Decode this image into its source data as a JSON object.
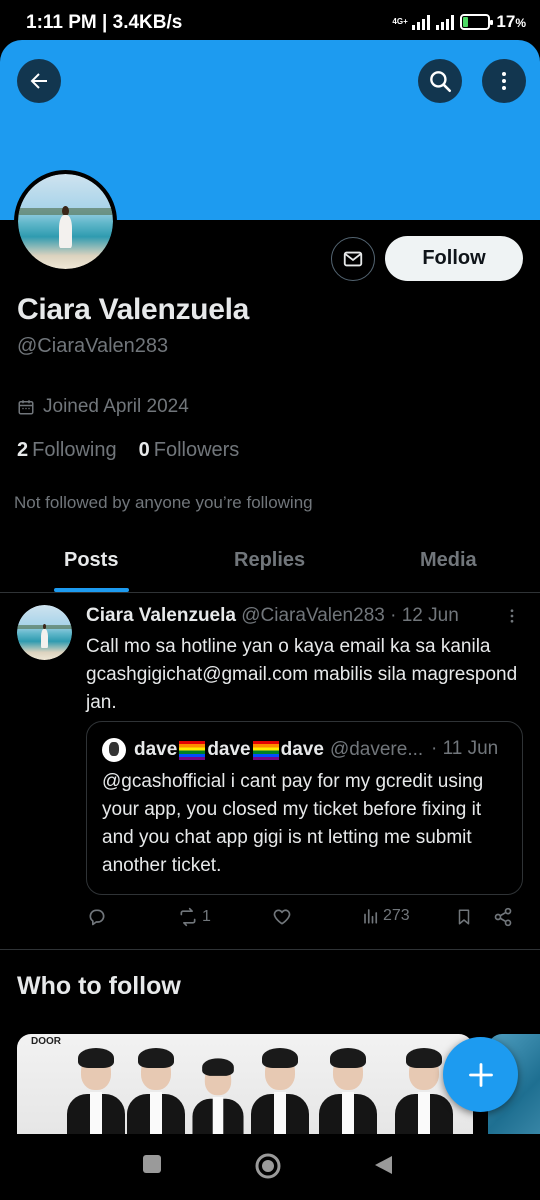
{
  "status_bar": {
    "time": "1:11 PM | 3.4KB/s",
    "network": "4G+",
    "battery": "17",
    "battery_suffix": "%"
  },
  "header": {
    "banner_color": "#1d9bf0",
    "back_icon": "arrow-left-icon",
    "search_icon": "search-icon",
    "more_icon": "more-vertical-icon"
  },
  "profile": {
    "display_name": "Ciara Valenzuela",
    "handle": "@CiaraValen283",
    "joined": "Joined April 2024",
    "following_count": "2",
    "following_label": "Following",
    "followers_count": "0",
    "followers_label": "Followers",
    "not_followed": "Not followed by anyone you’re following",
    "follow_label": "Follow",
    "message_icon": "mail-icon"
  },
  "tabs": [
    {
      "label": "Posts",
      "active": true
    },
    {
      "label": "Replies",
      "active": false
    },
    {
      "label": "Media",
      "active": false
    }
  ],
  "post": {
    "author": "Ciara Valenzuela",
    "handle": "@CiaraValen283",
    "separator": "·",
    "date": "12 Jun",
    "text": "Call mo sa hotline yan o kaya email ka sa kanila gcashgigichat@gmail.com mabilis sila magrespond jan.",
    "quote": {
      "name_part1": "dave",
      "name_part2": "dave",
      "name_part3": "dave",
      "handle": "@davere...",
      "date": "· 11 Jun",
      "text": "@gcashofficial i cant pay for my gcredit using your app, you closed my ticket before fixing it and you chat app gigi is nt letting me submit another ticket."
    },
    "actions": {
      "reply_count": "",
      "retweet_count": "1",
      "like_count": "",
      "views_count": "273"
    }
  },
  "who_to_follow": {
    "title": "Who to follow",
    "card_label": "DOOR"
  },
  "fab": {
    "icon": "plus-icon",
    "color": "#1d9bf0"
  },
  "nav": {
    "recents_icon": "square-icon",
    "home_icon": "circle-icon",
    "back_icon": "triangle-back-icon"
  }
}
